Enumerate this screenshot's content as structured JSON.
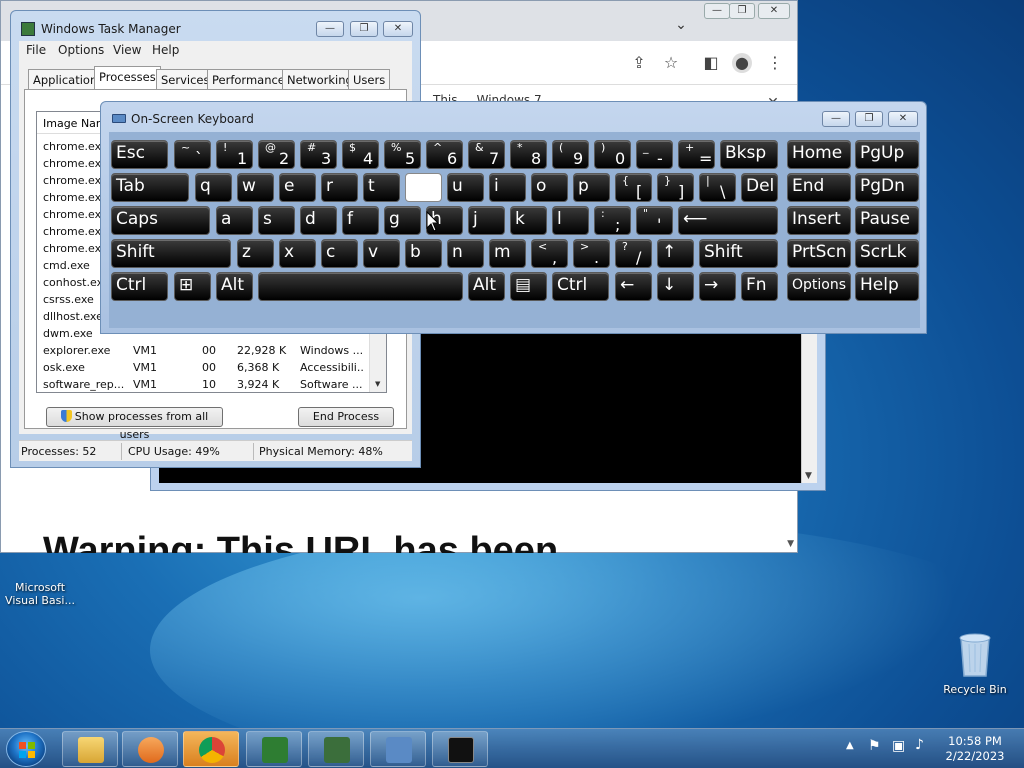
{
  "desktop": {
    "icons": [
      {
        "label": "Microsoft Visual Basi..."
      },
      {
        "label": "Recycle Bin"
      }
    ]
  },
  "browser": {
    "controls": {
      "minimize": "—",
      "maximize": "❐",
      "close": "✕",
      "tab_menu": "⌄"
    },
    "infobar_text": "This ... Windows 7 ...",
    "warning_heading": "Warning: This URL has been",
    "toolbar_icons": [
      "share-icon",
      "star-icon",
      "sidebar-icon",
      "profile-icon",
      "kebab-menu-icon"
    ]
  },
  "taskmgr": {
    "title": "Windows Task Manager",
    "menu": [
      "File",
      "Options",
      "View",
      "Help"
    ],
    "tabs": [
      "Applications",
      "Processes",
      "Services",
      "Performance",
      "Networking",
      "Users"
    ],
    "active_tab": "Processes",
    "column_header": "Image Name",
    "processes": [
      {
        "name": "chrome.exe",
        "user": "",
        "cpu": "",
        "mem": "",
        "desc": ""
      },
      {
        "name": "chrome.exe",
        "user": "",
        "cpu": "",
        "mem": "",
        "desc": ""
      },
      {
        "name": "chrome.exe",
        "user": "",
        "cpu": "",
        "mem": "",
        "desc": ""
      },
      {
        "name": "chrome.exe",
        "user": "",
        "cpu": "",
        "mem": "",
        "desc": ""
      },
      {
        "name": "chrome.exe",
        "user": "",
        "cpu": "",
        "mem": "",
        "desc": ""
      },
      {
        "name": "chrome.exe",
        "user": "",
        "cpu": "",
        "mem": "",
        "desc": ""
      },
      {
        "name": "chrome.exe",
        "user": "",
        "cpu": "",
        "mem": "",
        "desc": ""
      },
      {
        "name": "cmd.exe",
        "user": "",
        "cpu": "",
        "mem": "",
        "desc": ""
      },
      {
        "name": "conhost.exe",
        "user": "",
        "cpu": "",
        "mem": "",
        "desc": ""
      },
      {
        "name": "csrss.exe",
        "user": "",
        "cpu": "",
        "mem": "",
        "desc": ""
      },
      {
        "name": "dllhost.exe",
        "user": "",
        "cpu": "",
        "mem": "",
        "desc": ""
      },
      {
        "name": "dwm.exe",
        "user": "",
        "cpu": "",
        "mem": "",
        "desc": ""
      },
      {
        "name": "explorer.exe",
        "user": "VM1",
        "cpu": "00",
        "mem": "22,928 K",
        "desc": "Windows ..."
      },
      {
        "name": "osk.exe",
        "user": "VM1",
        "cpu": "00",
        "mem": "6,368 K",
        "desc": "Accessibili..."
      },
      {
        "name": "software_rep...",
        "user": "VM1",
        "cpu": "10",
        "mem": "3,924 K",
        "desc": "Software ..."
      }
    ],
    "show_all_button": "Show processes from all users",
    "end_process_button": "End Process",
    "status": {
      "processes": "Processes: 52",
      "cpu": "CPU Usage: 49%",
      "memory": "Physical Memory: 48%"
    },
    "controls": {
      "minimize": "—",
      "maximize": "❐",
      "close": "✕"
    }
  },
  "osk": {
    "title": "On-Screen Keyboard",
    "controls": {
      "minimize": "—",
      "maximize": "❐",
      "close": "✕"
    },
    "rows": [
      [
        {
          "main": "Esc"
        },
        {
          "top": "~",
          "bot": "`"
        },
        {
          "top": "!",
          "bot": "1"
        },
        {
          "top": "@",
          "bot": "2"
        },
        {
          "top": "#",
          "bot": "3"
        },
        {
          "top": "$",
          "bot": "4"
        },
        {
          "top": "%",
          "bot": "5"
        },
        {
          "top": "^",
          "bot": "6"
        },
        {
          "top": "&",
          "bot": "7"
        },
        {
          "top": "*",
          "bot": "8"
        },
        {
          "top": "(",
          "bot": "9"
        },
        {
          "top": ")",
          "bot": "0"
        },
        {
          "top": "_",
          "bot": "-"
        },
        {
          "top": "+",
          "bot": "="
        },
        {
          "main": "Bksp"
        },
        {
          "main": "Home"
        },
        {
          "main": "PgUp"
        }
      ],
      [
        {
          "main": "Tab"
        },
        {
          "main": "q"
        },
        {
          "main": "w"
        },
        {
          "main": "e"
        },
        {
          "main": "r"
        },
        {
          "main": "t"
        },
        {
          "main": "",
          "white": true
        },
        {
          "main": "u"
        },
        {
          "main": "i"
        },
        {
          "main": "o"
        },
        {
          "main": "p"
        },
        {
          "top": "{",
          "bot": "["
        },
        {
          "top": "}",
          "bot": "]"
        },
        {
          "top": "|",
          "bot": "\\"
        },
        {
          "main": "Del"
        },
        {
          "main": "End"
        },
        {
          "main": "PgDn"
        }
      ],
      [
        {
          "main": "Caps"
        },
        {
          "main": "a"
        },
        {
          "main": "s"
        },
        {
          "main": "d"
        },
        {
          "main": "f"
        },
        {
          "main": "g"
        },
        {
          "main": "h"
        },
        {
          "main": "j"
        },
        {
          "main": "k"
        },
        {
          "main": "l"
        },
        {
          "top": ":",
          "bot": ";"
        },
        {
          "top": "\"",
          "bot": "'"
        },
        {
          "main": "⟵"
        },
        {
          "main": "Insert"
        },
        {
          "main": "Pause"
        }
      ],
      [
        {
          "main": "Shift"
        },
        {
          "main": "z"
        },
        {
          "main": "x"
        },
        {
          "main": "c"
        },
        {
          "main": "v"
        },
        {
          "main": "b"
        },
        {
          "main": "n"
        },
        {
          "main": "m"
        },
        {
          "top": "<",
          "bot": ","
        },
        {
          "top": ">",
          "bot": "."
        },
        {
          "top": "?",
          "bot": "/"
        },
        {
          "main": "↑"
        },
        {
          "main": "Shift"
        },
        {
          "main": "PrtScn"
        },
        {
          "main": "ScrLk"
        }
      ],
      [
        {
          "main": "Ctrl"
        },
        {
          "main": "⊞"
        },
        {
          "main": "Alt"
        },
        {
          "main": ""
        },
        {
          "main": "Alt"
        },
        {
          "main": "▤"
        },
        {
          "main": "Ctrl"
        },
        {
          "main": "←"
        },
        {
          "main": "↓"
        },
        {
          "main": "→"
        },
        {
          "main": "Fn"
        },
        {
          "main": "Options"
        },
        {
          "main": "Help"
        }
      ]
    ]
  },
  "taskbar": {
    "apps": [
      "Windows Explorer",
      "Windows Media Player",
      "Google Chrome",
      "C# project",
      "Task Manager",
      "On-Screen Keyboard",
      "Command Prompt"
    ],
    "clock_time": "10:58 PM",
    "clock_date": "2/22/2023"
  },
  "colors": {
    "osk_key": "#1a1a1a",
    "osk_background": "#95b1d4",
    "taskbar": "#2f5f94"
  }
}
